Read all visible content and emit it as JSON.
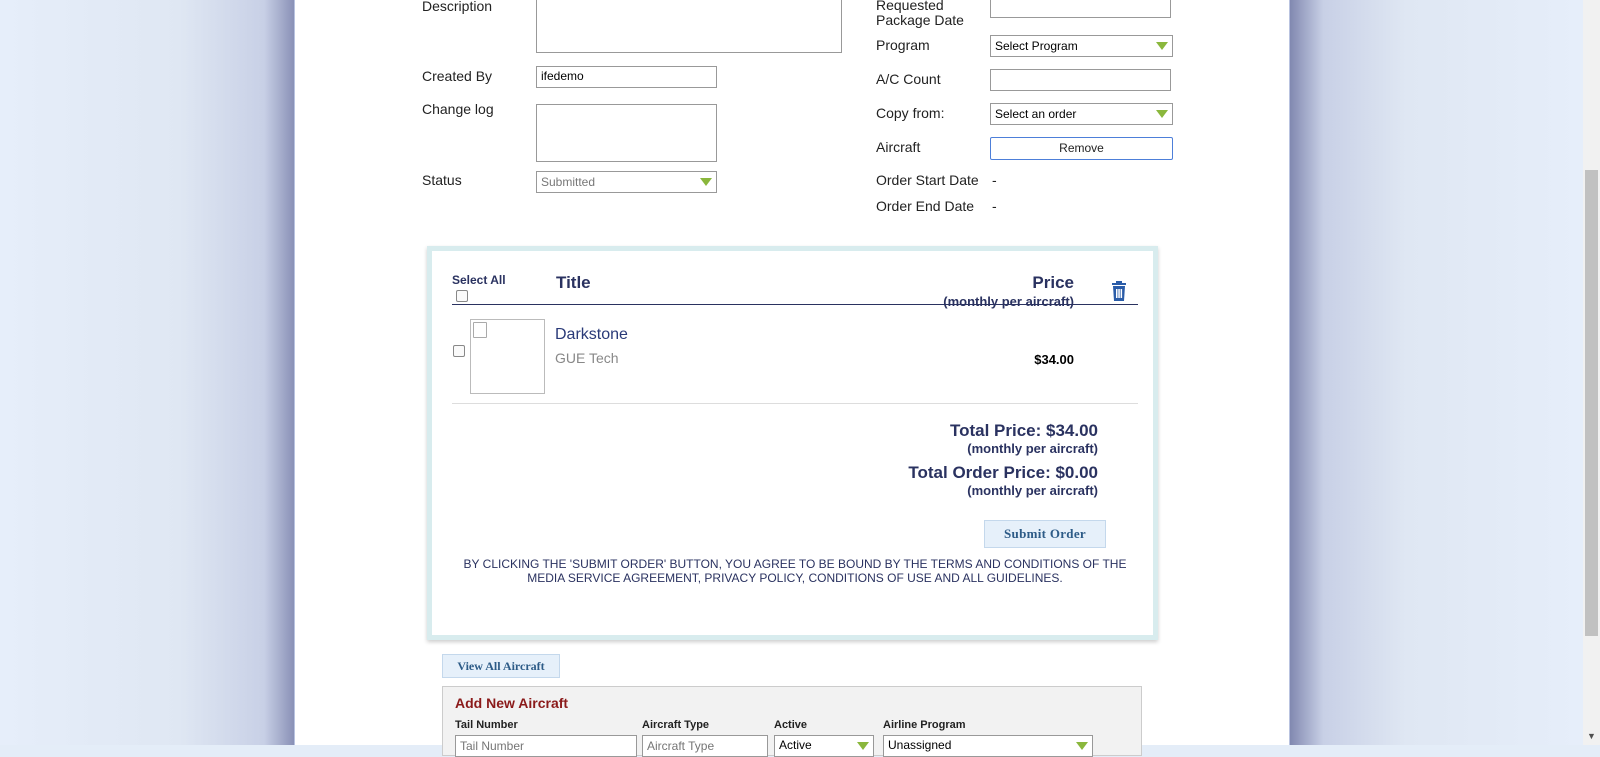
{
  "form": {
    "description_label": "Description",
    "created_by_label": "Created By",
    "created_by_value": "ifedemo",
    "change_log_label": "Change log",
    "status_label": "Status",
    "status_value": "Submitted",
    "requested_package_date_label": "Requested Package Date",
    "program_label": "Program",
    "program_value": "Select Program",
    "ac_count_label": "A/C Count",
    "copy_from_label": "Copy from:",
    "copy_from_value": "Select an order",
    "aircraft_label": "Aircraft",
    "remove_button": "Remove",
    "order_start_date_label": "Order Start Date",
    "order_start_date_value": "-",
    "order_end_date_label": "Order End Date",
    "order_end_date_value": "-"
  },
  "cart": {
    "select_all_label": "Select All",
    "title_header": "Title",
    "price_header": "Price",
    "price_subheader": "(monthly per aircraft)",
    "items": [
      {
        "title": "Darkstone",
        "provider": "GUE Tech",
        "price": "$34.00"
      }
    ],
    "total_price_label": "Total Price: $34.00",
    "total_price_sub": "(monthly per aircraft)",
    "total_order_price_label": "Total Order Price: $0.00",
    "total_order_price_sub": "(monthly per aircraft)",
    "submit_button": "Submit Order",
    "terms_text": "BY CLICKING THE 'SUBMIT ORDER' BUTTON, YOU AGREE TO BE BOUND BY THE TERMS AND CONDITIONS OF THE MEDIA SERVICE AGREEMENT, PRIVACY POLICY, CONDITIONS OF USE AND ALL GUIDELINES."
  },
  "aircraft": {
    "view_all_button": "View All Aircraft",
    "add_new_title": "Add New Aircraft",
    "tail_number_label": "Tail Number",
    "tail_number_placeholder": "Tail Number",
    "aircraft_type_label": "Aircraft Type",
    "aircraft_type_placeholder": "Aircraft Type",
    "active_label": "Active",
    "active_value": "Active",
    "airline_program_label": "Airline Program",
    "airline_program_value": "Unassigned"
  },
  "colors": {
    "accent_navy": "#2a3260",
    "dropdown_caret": "#8ab73c",
    "cart_border": "#d8ecee",
    "add_title_red": "#8b1a1a"
  },
  "icons": [
    "trash-icon",
    "chevron-down-icon",
    "broken-image-icon",
    "checkbox-icon"
  ]
}
